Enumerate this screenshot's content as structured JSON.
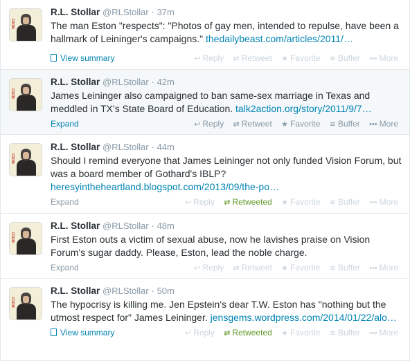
{
  "tweets": [
    {
      "name": "R.L. Stollar",
      "handle": "@RLStollar",
      "time": "37m",
      "text": "The man Eston \"respects\": \"Photos of gay men, intended to repulse, have been a hallmark of Leininger's campaigns.\" ",
      "link": "thedailybeast.com/articles/2011/…",
      "footer_link": "View summary",
      "actions": {
        "reply": "Reply",
        "retweet": "Retweet",
        "favorite": "Favorite",
        "buffer": "Buffer",
        "more": "More"
      }
    },
    {
      "name": "R.L. Stollar",
      "handle": "@RLStollar",
      "time": "42m",
      "text": "James Leininger also campaigned to ban same-sex marriage in Texas and meddled in TX's State Board of Education. ",
      "link": "talk2action.org/story/2011/9/7…",
      "footer_link": "Expand",
      "actions": {
        "reply": "Reply",
        "retweet": "Retweet",
        "favorite": "Favorite",
        "buffer": "Buffer",
        "more": "More"
      }
    },
    {
      "name": "R.L. Stollar",
      "handle": "@RLStollar",
      "time": "44m",
      "text": "Should I remind everyone that James Leininger not only funded Vision Forum, but was a board member of Gothard's IBLP? ",
      "link": "heresyintheheartland.blogspot.com/2013/09/the-po…",
      "footer_link": "Expand",
      "actions": {
        "reply": "Reply",
        "retweet": "Retweeted",
        "favorite": "Favorite",
        "buffer": "Buffer",
        "more": "More"
      }
    },
    {
      "name": "R.L. Stollar",
      "handle": "@RLStollar",
      "time": "48m",
      "text": "First Eston outs a victim of sexual abuse, now he lavishes praise on Vision Forum's sugar daddy. Please, Eston, lead the noble charge.",
      "link": "",
      "footer_link": "Expand",
      "actions": {
        "reply": "Reply",
        "retweet": "Retweet",
        "favorite": "Favorite",
        "buffer": "Buffer",
        "more": "More"
      }
    },
    {
      "name": "R.L. Stollar",
      "handle": "@RLStollar",
      "time": "50m",
      "text": "The hypocrisy is killing me. Jen Epstein's dear T.W. Eston has \"nothing but the utmost respect for\" James Leininger. ",
      "link": "jensgems.wordpress.com/2014/01/22/alo…",
      "footer_link": "View summary",
      "actions": {
        "reply": "Reply",
        "retweet": "Retweeted",
        "favorite": "Favorite",
        "buffer": "Buffer",
        "more": "More"
      }
    }
  ],
  "avatar_watermark": "FROM",
  "colors": {
    "link": "#0084b4",
    "retweeted": "#609928",
    "muted": "#8899a6",
    "faint": "#ccd6dd"
  },
  "icons": {
    "reply": "reply-icon",
    "retweet": "retweet-icon",
    "favorite": "star-icon",
    "buffer": "buffer-icon",
    "more": "more-dots-icon",
    "summary": "document-icon"
  }
}
